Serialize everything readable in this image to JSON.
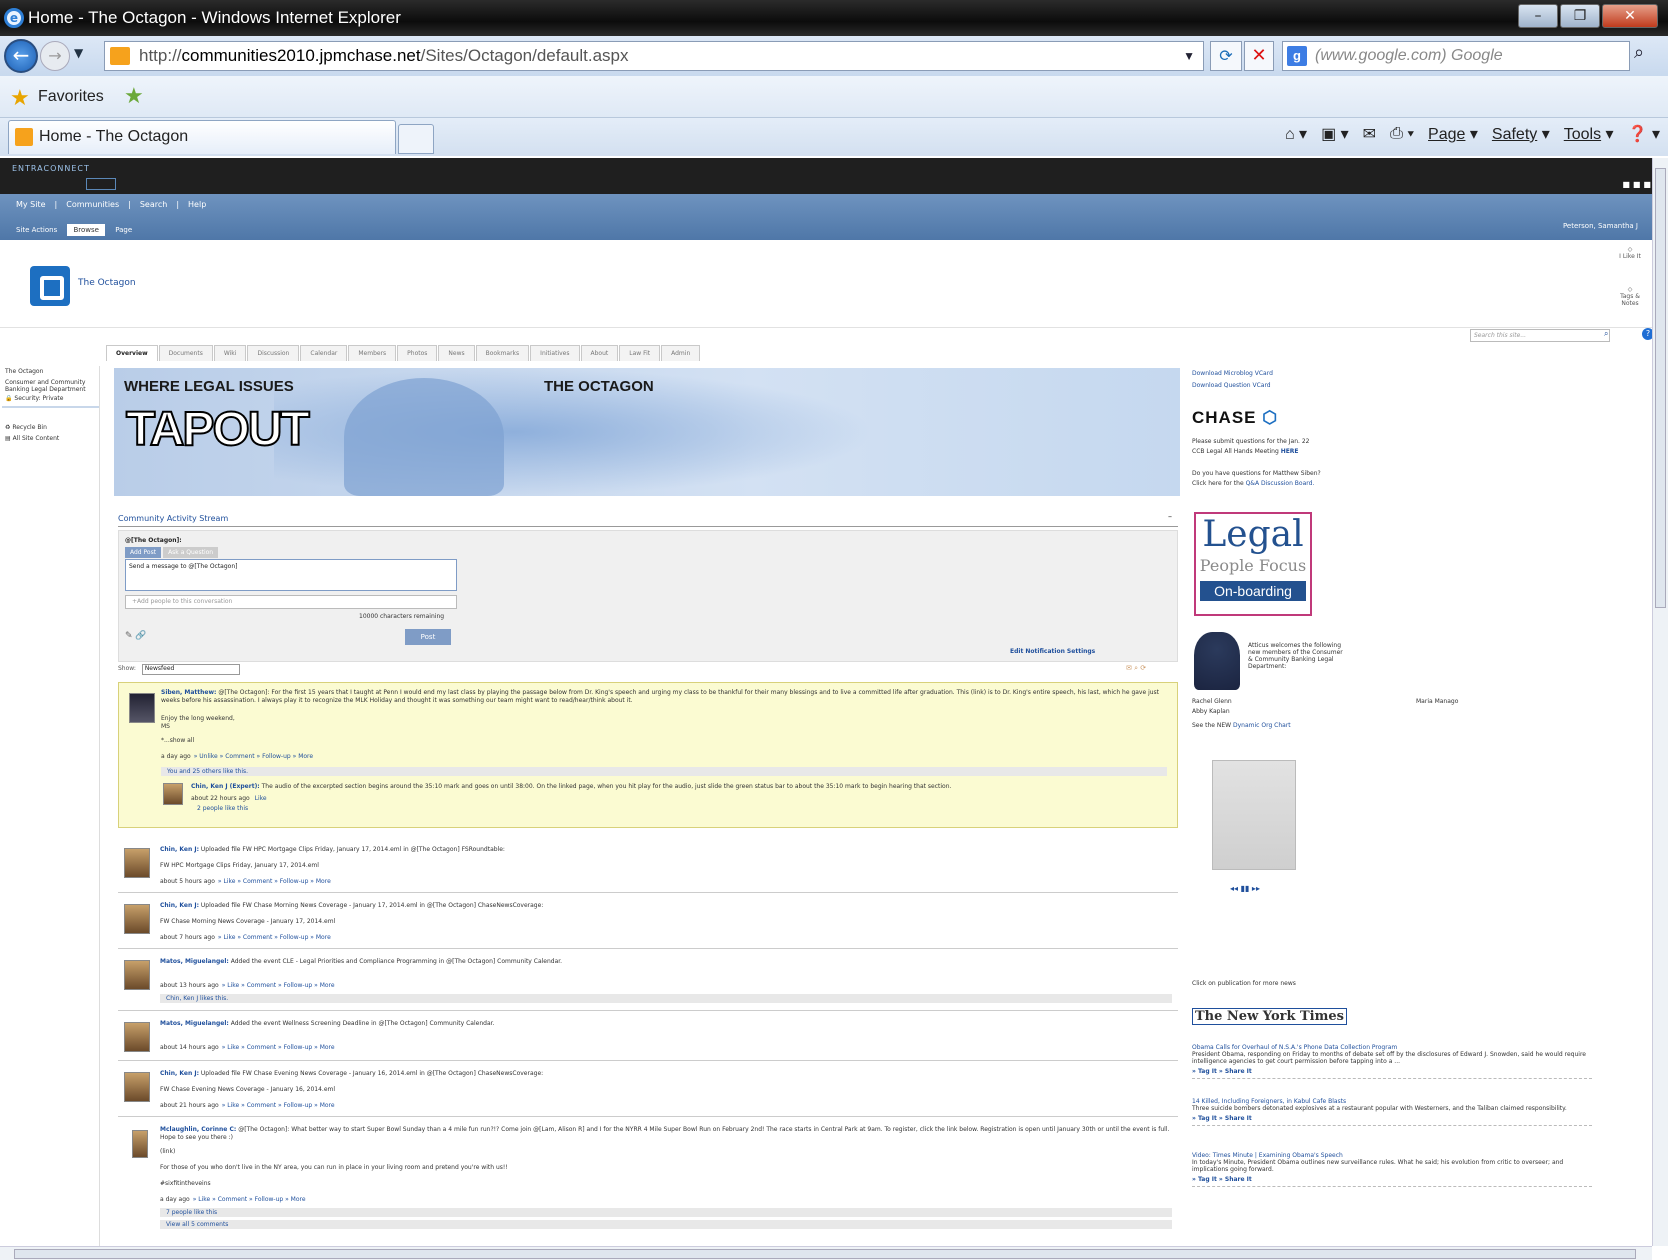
{
  "window": {
    "title": "Home - The Octagon - Windows Internet Explorer"
  },
  "address": {
    "url_prefix": "http://",
    "url_host": "communities2010.jpmchase.net",
    "url_path": "/Sites/Octagon/default.aspx",
    "search_placeholder": "(www.google.com) Google"
  },
  "favorites": {
    "label": "Favorites"
  },
  "tab": {
    "label": "Home - The Octagon"
  },
  "commandbar": {
    "page": "Page",
    "safety": "Safety",
    "tools": "Tools"
  },
  "sp": {
    "brand": "ENTRACONNECT",
    "top_links": [
      "My Site",
      "|",
      "Communities",
      "|",
      "Search",
      "|",
      "Help"
    ],
    "ribbon": [
      "Site Actions",
      "Browse",
      "Page"
    ],
    "user": "Peterson, Samantha J",
    "site_title": "The Octagon",
    "site_search_placeholder": "Search this site...",
    "right_icons": [
      "I Like It",
      "Tags & Notes"
    ]
  },
  "tabs": [
    "Overview",
    "Documents",
    "Wiki",
    "Discussion",
    "Calendar",
    "Members",
    "Photos",
    "News",
    "Bookmarks",
    "Initiatives",
    "About",
    "Law Fit",
    "Admin"
  ],
  "quicklaunch": {
    "site": "The Octagon",
    "dept": "Consumer and Community Banking Legal Department",
    "security": "Security: Private",
    "recycle": "Recycle Bin",
    "all": "All Site Content"
  },
  "banner": {
    "left": "WHERE LEGAL ISSUES",
    "right": "THE OCTAGON",
    "logo": "TAPOUT"
  },
  "stream": {
    "title": "Community Activity Stream",
    "to": "@[The Octagon]:",
    "tab_add": "Add Post",
    "tab_ask": "Ask a Question",
    "msg": "Send a message to @[The Octagon]",
    "people": "+Add people to this conversation",
    "remaining": "10000 characters remaining",
    "post": "Post",
    "notif": "Edit Notification Settings",
    "show_label": "Show:",
    "show_value": "Newsfeed"
  },
  "posts": [
    {
      "author": "Siben, Matthew:",
      "body": "@[The Octagon]: For the first 15 years that I taught at Penn I would end my last class by playing the passage below from Dr. King's speech and urging my class to be thankful for their many blessings and to live a committed life after graduation. This (link) is to Dr. King's entire speech, his last, which he gave just weeks before his assassination. I always play it to recognize the MLK Holiday and thought it was something our team might want to read/hear/think about it.",
      "line2": "Enjoy the long weekend,",
      "line3": "MS",
      "more": "*...show all",
      "meta": "a day ago",
      "actions": "» Unlike » Comment » Follow-up » More",
      "likes": "You and 25 others like this.",
      "reply_author": "Chin, Ken J (Expert):",
      "reply_body": "The audio of the excerpted section begins around the 35:10 mark and goes on until 38:00. On the linked page, when you hit play for the audio, just slide the green status bar to about the 35:10 mark to begin hearing that section.",
      "reply_meta": "about 22 hours ago",
      "reply_like": "Like",
      "reply_likes": "2 people like this"
    },
    {
      "author": "Chin, Ken J:",
      "body": "Uploaded file FW HPC Mortgage Clips Friday, January 17, 2014.eml in @[The Octagon] FSRoundtable:",
      "file": "FW HPC Mortgage Clips Friday, January 17, 2014.eml",
      "meta": "about 5 hours ago",
      "actions": "» Like » Comment » Follow-up » More"
    },
    {
      "author": "Chin, Ken J:",
      "body": "Uploaded file FW Chase Morning News Coverage - January 17, 2014.eml in @[The Octagon] ChaseNewsCoverage:",
      "file": "FW Chase Morning News Coverage - January 17, 2014.eml",
      "meta": "about 7 hours ago",
      "actions": "» Like » Comment » Follow-up » More"
    },
    {
      "author": "Matos, Miguelangel:",
      "body": "Added the event CLE - Legal Priorities and Compliance Programming in @[The Octagon] Community Calendar.",
      "meta": "about 13 hours ago",
      "actions": "» Like » Comment » Follow-up » More",
      "likes": "Chin, Ken J likes this."
    },
    {
      "author": "Matos, Miguelangel:",
      "body": "Added the event Wellness Screening Deadline in @[The Octagon] Community Calendar.",
      "meta": "about 14 hours ago",
      "actions": "» Like » Comment » Follow-up » More"
    },
    {
      "author": "Chin, Ken J:",
      "body": "Uploaded file FW Chase Evening News Coverage - January 16, 2014.eml in @[The Octagon] ChaseNewsCoverage:",
      "file": "FW Chase Evening News Coverage - January 16, 2014.eml",
      "meta": "about 21 hours ago",
      "actions": "» Like » Comment » Follow-up » More"
    },
    {
      "author": "Mclaughlin, Corinne C:",
      "body": "@[The Octagon]: What better way to start Super Bowl Sunday than a 4 mile fun run?!? Come join @[Lam, Alison R] and I for the NYRR 4 Mile Super Bowl Run on February 2nd! The race starts in Central Park at 9am. To register, click the link below. Registration is open until January 30th or until the event is full. Hope to see you there :)",
      "link": "(link)",
      "line2": "For those of you who don't live in the NY area, you can run in place in your living room and pretend you're with us!!",
      "tag": "#sixfitintheveins",
      "meta": "a day ago",
      "actions": "» Like » Comment » Follow-up » More",
      "likes": "7 people like this",
      "comments": "View all 5 comments"
    }
  ],
  "right": {
    "vcard1": "Download Microblog VCard",
    "vcard2": "Download Question VCard",
    "chase": "CHASE",
    "submit1": "Please submit questions for the Jan. 22",
    "submit2": "CCB Legal All Hands Meeting",
    "here": "HERE",
    "q1": "Do you have questions for Matthew Siben?",
    "q2": "Click here for the",
    "qa": "Q&A Discussion Board.",
    "legal_a": "Legal",
    "legal_b": "People Focus",
    "legal_c": "On-boarding",
    "atticus": "Atticus welcomes the following new members of the Consumer & Community Banking Legal Department:",
    "m1": "Rachel Glenn",
    "m2": "Maria Manago",
    "m3": "Abby Kaplan",
    "org1": "See the NEW",
    "org2": "Dynamic Org Chart",
    "player": "◂◂  ▮▮  ▸▸",
    "clickpub": "Click on publication for more news",
    "nyt": "The New York Times",
    "news": [
      {
        "t": "Obama Calls for Overhaul of N.S.A.'s Phone Data Collection Program",
        "d": "President Obama, responding on Friday to months of debate set off by the disclosures of Edward J. Snowden, said he would require intelligence agencies to get court permission before tapping into a ...",
        "tags": "» Tag It  » Share It"
      },
      {
        "t": "14 Killed, Including Foreigners, in Kabul Cafe Blasts",
        "d": "Three suicide bombers detonated explosives at a restaurant popular with Westerners, and the Taliban claimed responsibility.",
        "tags": "» Tag It  » Share It"
      },
      {
        "t": "Video: Times Minute | Examining Obama's Speech",
        "d": "In today's Minute, President Obama outlines new surveillance rules. What he said; his evolution from critic to overseer; and implications going forward.",
        "tags": "» Tag It  » Share It"
      }
    ]
  }
}
